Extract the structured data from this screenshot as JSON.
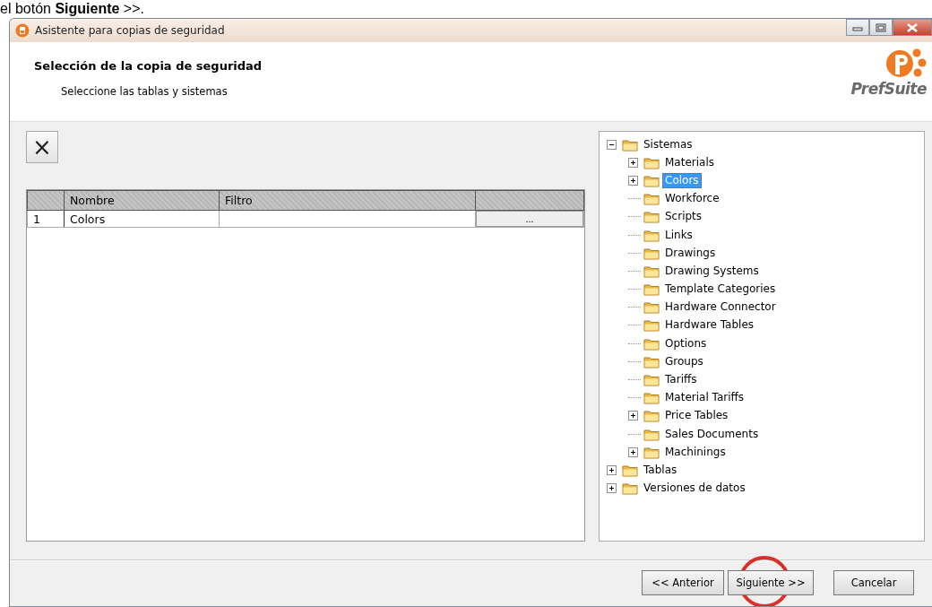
{
  "document_text": "el botón **Siguiente** >>.",
  "window": {
    "title": "Asistente para copias de seguridad"
  },
  "header": {
    "title": "Selección de la copia de seguridad",
    "subtitle": "Seleccione las tablas y sistemas",
    "logo_text": "PrefSuite"
  },
  "toolbar": {
    "delete_button": "×"
  },
  "table": {
    "columns": [
      "Nombre",
      "Filtro"
    ],
    "rows": [
      {
        "number": "1",
        "name": "Colors",
        "filter": "",
        "button": "..."
      }
    ]
  },
  "tree": [
    {
      "label": "Sistemas",
      "expanded": true,
      "selected": false,
      "children": [
        {
          "label": "Materials",
          "expanded": false,
          "selected": false
        },
        {
          "label": "Colors",
          "expanded": false,
          "selected": true
        },
        {
          "label": "Workforce",
          "selected": false
        },
        {
          "label": "Scripts",
          "selected": false
        },
        {
          "label": "Links",
          "selected": false
        },
        {
          "label": "Drawings",
          "selected": false
        },
        {
          "label": "Drawing Systems",
          "selected": false
        },
        {
          "label": "Template Categories",
          "selected": false
        },
        {
          "label": "Hardware Connector",
          "selected": false
        },
        {
          "label": "Hardware Tables",
          "selected": false
        },
        {
          "label": "Options",
          "selected": false
        },
        {
          "label": "Groups",
          "selected": false
        },
        {
          "label": "Tariffs",
          "selected": false
        },
        {
          "label": "Material Tariffs",
          "selected": false
        },
        {
          "label": "Price Tables",
          "expanded": false,
          "selected": false
        },
        {
          "label": "Sales Documents",
          "selected": false
        },
        {
          "label": "Machinings",
          "expanded": false,
          "selected": false
        }
      ]
    },
    {
      "label": "Tablas",
      "expanded": false,
      "selected": false
    },
    {
      "label": "Versiones de datos",
      "expanded": false,
      "selected": false
    }
  ],
  "buttons": [
    {
      "kind": "back",
      "label": "<< Anterior"
    },
    {
      "kind": "next",
      "label": "Siguiente >>"
    },
    {
      "kind": "cancel",
      "label": "Cancelar"
    }
  ]
}
